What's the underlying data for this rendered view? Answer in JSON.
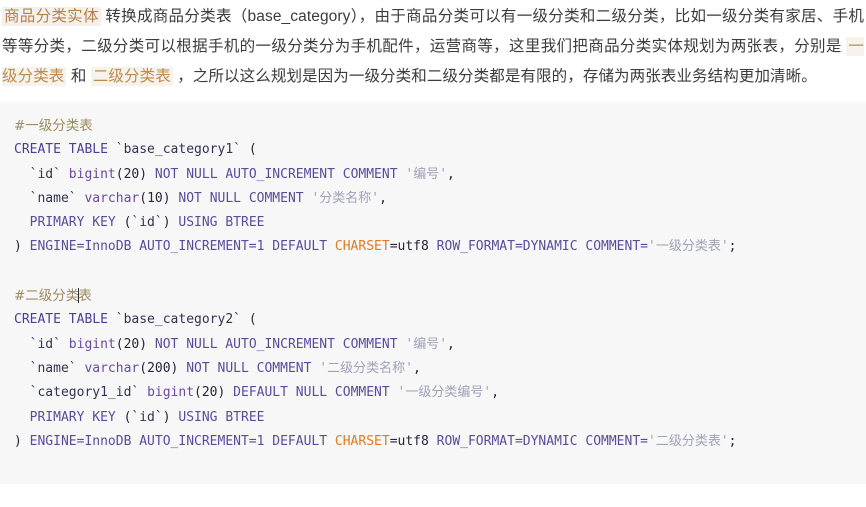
{
  "intro": {
    "highlight_entity": "商品分类实体",
    "seg1": " 转换成商品分类表（base_category），由于商品分类可以有一级分类和二级分类，比如一级分类有家居、手机等等分类，二级分类可以根据手机的一级分类分为手机配件，运营商等，这里我们把商品分类实体规划为两张表，分别是 ",
    "highlight_table1": "一级分类表",
    "seg2": " 和 ",
    "highlight_table2": "二级分类表",
    "seg3": " ，之所以这么规划是因为一级分类和二级分类都是有限的，存储为两张表业务结构更加清晰。"
  },
  "colors": {
    "highlight_entity_text": "#b5804a",
    "highlight_entity_bg": "#f5f1ea",
    "highlight_table_text": "#c08a4e",
    "code_bg": "#f7f7f7",
    "keyword": "#4b3f8f",
    "type": "#6b4aa0",
    "string": "#9fa3b8",
    "comment": "#9b8b5e",
    "charset_accent": "#e07b21",
    "identifier": "#2f3452"
  },
  "code": {
    "block1": {
      "comment": "#一级分类表",
      "line_create": {
        "kw": "CREATE TABLE",
        "ident": "`base_category1`",
        "paren": "("
      },
      "col_id": {
        "ident": "`id`",
        "type": "bigint",
        "size": "(20)",
        "kw": "NOT NULL AUTO_INCREMENT COMMENT",
        "str": "'编号'",
        "comma": ","
      },
      "col_name": {
        "ident": "`name`",
        "type": "varchar",
        "size": "(10)",
        "kw": "NOT NULL COMMENT",
        "str": "'分类名称'",
        "comma": ","
      },
      "primary_key": {
        "kw": "PRIMARY KEY",
        "paren_open": "(",
        "ident": "`id`",
        "paren_close": ")",
        "kw2": "USING BTREE"
      },
      "tail": {
        "close": ")",
        "engine": "ENGINE=InnoDB AUTO_INCREMENT=1 DEFAULT",
        "charset_key": "CHARSET",
        "charset_val": "=utf8",
        "rowformat": "ROW_FORMAT=DYNAMIC COMMENT=",
        "comment_str": "'一级分类表'",
        "semi": ";"
      }
    },
    "block2": {
      "comment_before_caret": "#二级分类",
      "comment_after_caret": "表",
      "line_create": {
        "kw": "CREATE TABLE",
        "ident": "`base_category2`",
        "paren": "("
      },
      "col_id": {
        "ident": "`id`",
        "type": "bigint",
        "size": "(20)",
        "kw": "NOT NULL AUTO_INCREMENT COMMENT",
        "str": "'编号'",
        "comma": ","
      },
      "col_name": {
        "ident": "`name`",
        "type": "varchar",
        "size": "(200)",
        "kw": "NOT NULL COMMENT",
        "str": "'二级分类名称'",
        "comma": ","
      },
      "col_category1_id": {
        "ident": "`category1_id`",
        "type": "bigint",
        "size": "(20)",
        "kw": "DEFAULT NULL COMMENT",
        "str": "'一级分类编号'",
        "comma": ","
      },
      "primary_key": {
        "kw": "PRIMARY KEY",
        "paren_open": "(",
        "ident": "`id`",
        "paren_close": ")",
        "kw2": "USING BTREE"
      },
      "tail": {
        "close": ")",
        "engine": "ENGINE=InnoDB AUTO_INCREMENT=1 DEFAULT",
        "charset_key": "CHARSET",
        "charset_val": "=utf8",
        "rowformat": "ROW_FORMAT=DYNAMIC COMMENT=",
        "comment_str": "'二级分类表'",
        "semi": ";"
      }
    }
  }
}
